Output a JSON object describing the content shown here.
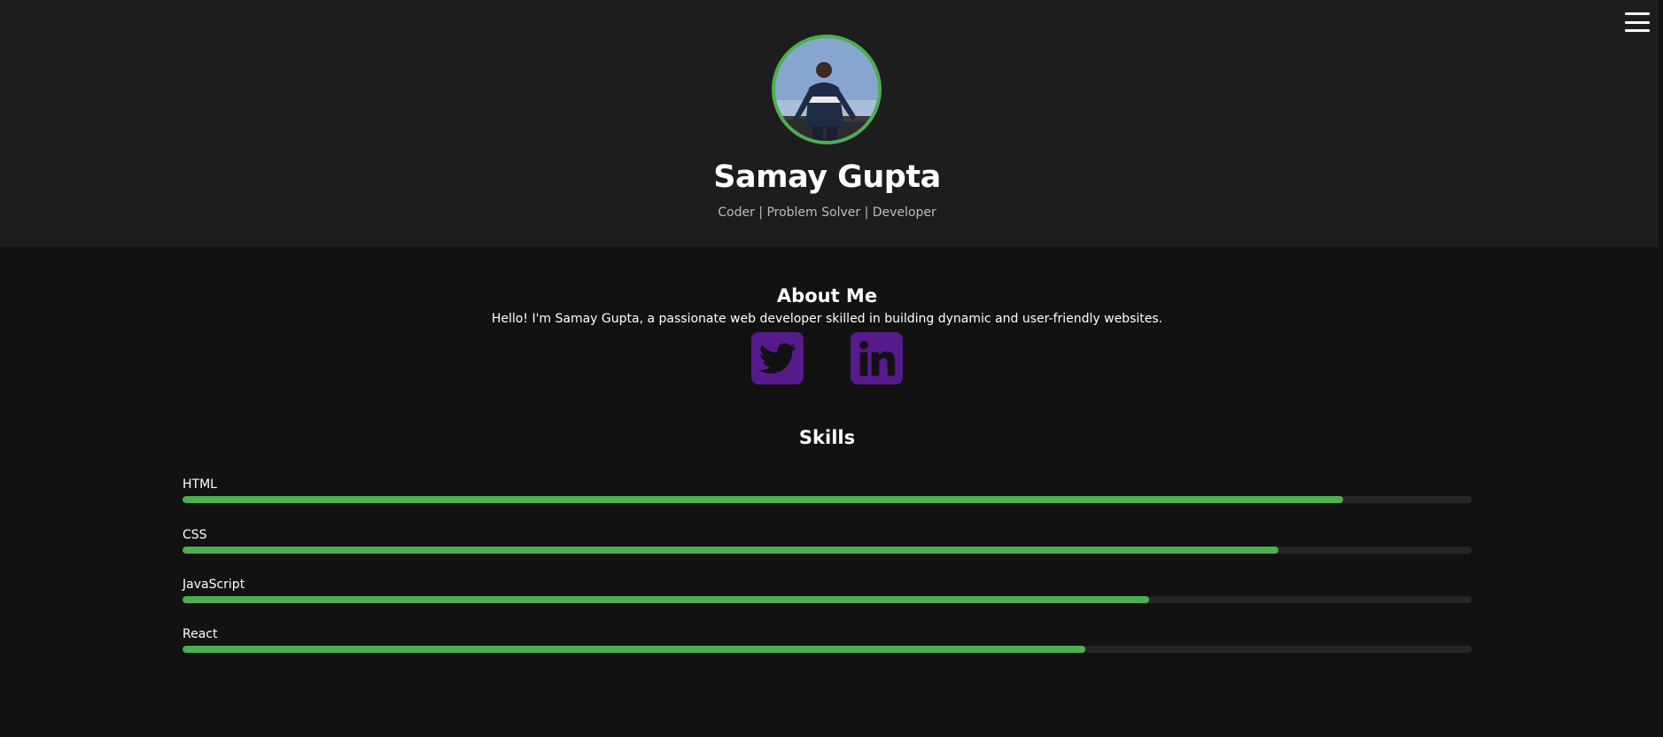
{
  "header": {
    "name": "Samay Gupta",
    "tagline": "Coder | Problem Solver | Developer",
    "menu_icon": "hamburger-menu-icon",
    "avatar_border_color": "#4caf50"
  },
  "about": {
    "title": "About Me",
    "text": "Hello! I'm Samay Gupta, a passionate web developer skilled in building dynamic and user-friendly websites."
  },
  "social": {
    "items": [
      {
        "icon": "twitter-icon",
        "color": "#561a8c"
      },
      {
        "icon": "linkedin-icon",
        "color": "#561a8c"
      }
    ]
  },
  "skills": {
    "title": "Skills",
    "fill_color": "#4caf50",
    "items": [
      {
        "label": "HTML",
        "level": 0.9
      },
      {
        "label": "CSS",
        "level": 0.85
      },
      {
        "label": "JavaScript",
        "level": 0.75
      },
      {
        "label": "React",
        "level": 0.7
      }
    ]
  }
}
